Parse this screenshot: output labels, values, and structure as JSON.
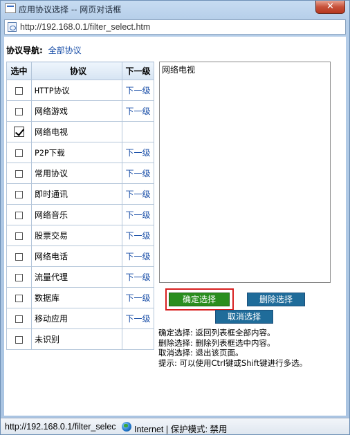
{
  "window": {
    "title": "应用协议选择 -- 网页对话框",
    "close_label": "✕",
    "address": "http://192.168.0.1/filter_select.htm"
  },
  "nav": {
    "label": "协议导航:",
    "link": "全部协议"
  },
  "table": {
    "headers": {
      "select": "选中",
      "protocol": "协议",
      "next": "下一级"
    },
    "rows": [
      {
        "name": "HTTP协议",
        "checked": false,
        "next": "下一级"
      },
      {
        "name": "网络游戏",
        "checked": false,
        "next": "下一级"
      },
      {
        "name": "网络电视",
        "checked": true,
        "next": ""
      },
      {
        "name": "P2P下载",
        "checked": false,
        "next": "下一级"
      },
      {
        "name": "常用协议",
        "checked": false,
        "next": "下一级"
      },
      {
        "name": "即时通讯",
        "checked": false,
        "next": "下一级"
      },
      {
        "name": "网络音乐",
        "checked": false,
        "next": "下一级"
      },
      {
        "name": "股票交易",
        "checked": false,
        "next": "下一级"
      },
      {
        "name": "网络电话",
        "checked": false,
        "next": "下一级"
      },
      {
        "name": "流量代理",
        "checked": false,
        "next": "下一级"
      },
      {
        "name": "数据库",
        "checked": false,
        "next": "下一级"
      },
      {
        "name": "移动应用",
        "checked": false,
        "next": "下一级"
      },
      {
        "name": "未识别",
        "checked": false,
        "next": ""
      }
    ]
  },
  "selected_list": [
    "网络电视"
  ],
  "buttons": {
    "confirm": "确定选择",
    "delete": "删除选择",
    "cancel": "取消选择"
  },
  "help": [
    "确定选择: 返回列表框全部内容。",
    "删除选择: 删除列表框选中内容。",
    "取消选择: 退出该页面。",
    "提示: 可以使用Ctrl键或Shift键进行多选。"
  ],
  "status": {
    "url": "http://192.168.0.1/filter_selec",
    "zone": "Internet | 保护模式: 禁用"
  },
  "colors": {
    "accent_green": "#2a8e1e",
    "accent_blue": "#1f6c9a",
    "highlight_red": "#d81e1e",
    "link_blue": "#1a4fa8"
  }
}
